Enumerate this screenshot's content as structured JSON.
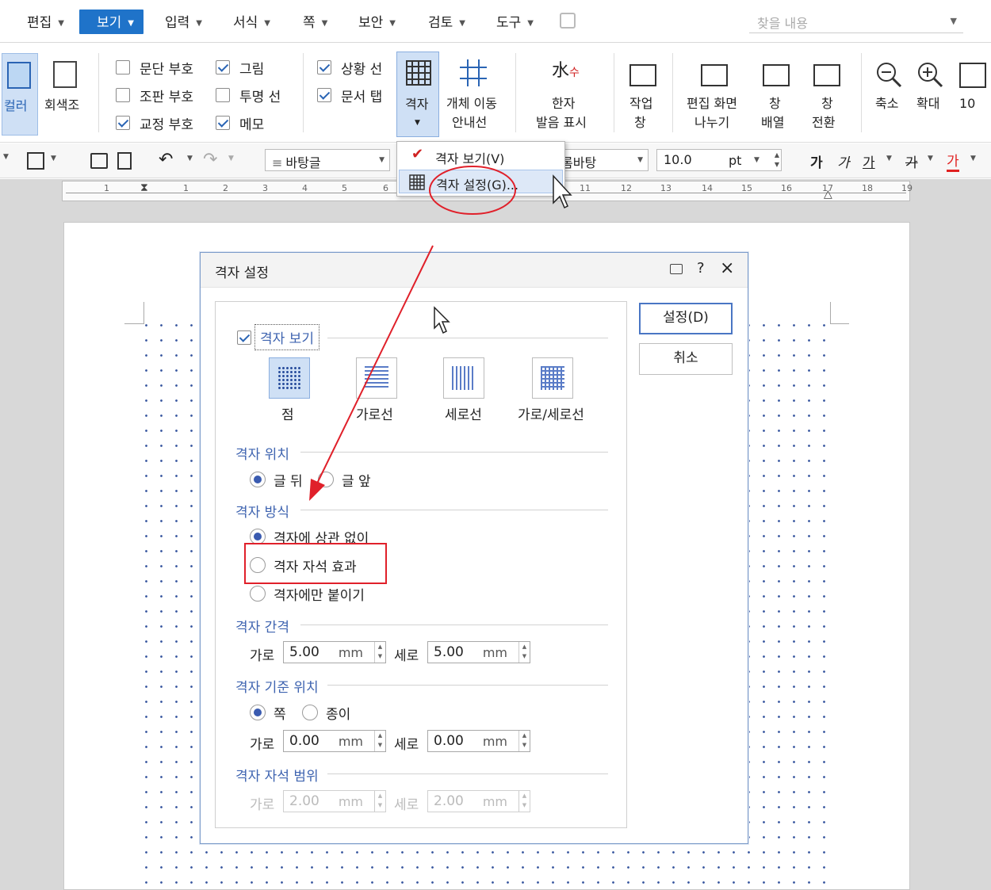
{
  "menu": {
    "items": [
      "편집",
      "보기",
      "입력",
      "서식",
      "쪽",
      "보안",
      "검토",
      "도구"
    ],
    "active_index": 1,
    "search_placeholder": "찾을 내용"
  },
  "ribbon": {
    "color_label": "컬러",
    "grayscale_label": "회색조",
    "checks": [
      {
        "label": "문단 부호",
        "checked": false
      },
      {
        "label": "그림",
        "checked": true
      },
      {
        "label": "상황 선",
        "checked": true
      },
      {
        "label": "조판 부호",
        "checked": false
      },
      {
        "label": "투명 선",
        "checked": false
      },
      {
        "label": "문서 탭",
        "checked": true
      },
      {
        "label": "교정 부호",
        "checked": true
      },
      {
        "label": "메모",
        "checked": true
      }
    ],
    "grid_label": "격자",
    "object_move_line1": "개체 이동",
    "object_move_line2": "안내선",
    "hanja_line1": "한자",
    "hanja_line2": "발음 표시",
    "work_line1": "작업",
    "work_line2": "창",
    "split_line1": "편집 화면",
    "split_line2": "나누기",
    "arrange_line1": "창",
    "arrange_line2": "배열",
    "switch_line1": "창",
    "switch_line2": "전환",
    "zoom_out": "축소",
    "zoom_in": "확대",
    "zoom_percent_partial": "10"
  },
  "toolbar": {
    "style_value": "바탕글",
    "font_value": "롬바탕",
    "size_value": "10.0",
    "size_unit": "pt",
    "fmt_bold": "가",
    "fmt_italic": "가",
    "fmt_underline": "가",
    "fmt_strike": "가",
    "fmt_color": "가",
    "font_color": "#e02020"
  },
  "ruler": {
    "numbers": [
      "1",
      "1",
      "2",
      "3",
      "4",
      "5",
      "6",
      "11",
      "12",
      "13",
      "14",
      "15",
      "16",
      "17",
      "18",
      "19"
    ]
  },
  "dropdown": {
    "item1": "격자 보기(V)",
    "item2": "격자 설정(G)..."
  },
  "dialog": {
    "title": "격자 설정",
    "help_glyph": "?",
    "close_glyph": "×",
    "show_grid_label": "격자 보기",
    "grid_types": [
      "점",
      "가로선",
      "세로선",
      "가로/세로선"
    ],
    "position": {
      "title": "격자 위치",
      "options": [
        "글 뒤",
        "글 앞"
      ],
      "selected": 0
    },
    "method": {
      "title": "격자 방식",
      "options": [
        "격자에 상관 없이",
        "격자 자석 효과",
        "격자에만 붙이기"
      ],
      "selected": 0
    },
    "spacing": {
      "title": "격자 간격",
      "h_label": "가로",
      "h_value": "5.00",
      "v_label": "세로",
      "v_value": "5.00",
      "unit": "mm"
    },
    "origin": {
      "title": "격자 기준 위치",
      "options": [
        "쪽",
        "종이"
      ],
      "selected": 0,
      "h_label": "가로",
      "h_value": "0.00",
      "v_label": "세로",
      "v_value": "0.00",
      "unit": "mm"
    },
    "magnet": {
      "title": "격자 자석 범위",
      "h_label": "가로",
      "h_value": "2.00",
      "v_label": "세로",
      "v_value": "2.00",
      "unit": "mm"
    },
    "ok_label": "설정(D)",
    "cancel_label": "취소"
  },
  "annotation_color": "#e0202a"
}
